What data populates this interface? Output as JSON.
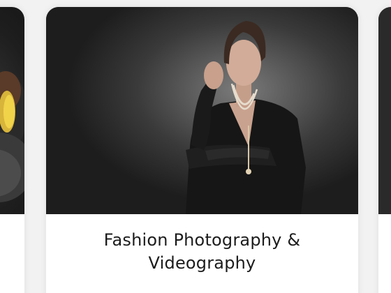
{
  "cards": {
    "center": {
      "title_line1": "Fashion Photography &",
      "title_line2": "Videography",
      "image": "fashion-portrait"
    },
    "left": {
      "image": "partial-portrait"
    },
    "right": {
      "image": "partial-dark-image"
    }
  },
  "colors": {
    "page_background": "#f2f2f2",
    "card_background": "#ffffff",
    "caption_text": "#1c1c1c",
    "photo_background": "#2c2c2c"
  }
}
